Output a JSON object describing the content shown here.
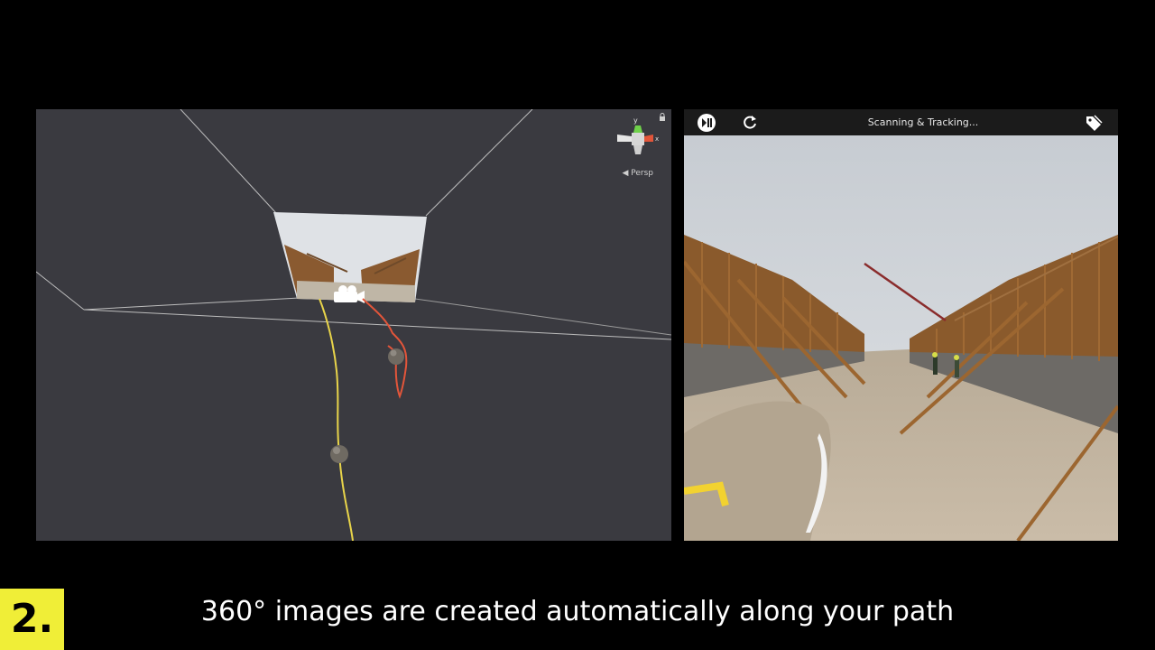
{
  "scene_view": {
    "projection_label": "Persp",
    "gizmo_axis_y": "y",
    "gizmo_axis_x": "x",
    "icons": [
      "camera-icon",
      "lock-icon",
      "scene-gizmo-icon"
    ],
    "path_colors": {
      "primary": "#e8d44a",
      "secondary": "#e2553a"
    }
  },
  "viewer": {
    "status": "Scanning & Tracking...",
    "icons": [
      "play-pause-icon",
      "refresh-icon",
      "tag-icon"
    ]
  },
  "step": {
    "number": "2."
  },
  "caption": "360° images are created automatically along your path",
  "colors": {
    "badge": "#f0ee37",
    "panel_bg": "#3a3a40"
  }
}
